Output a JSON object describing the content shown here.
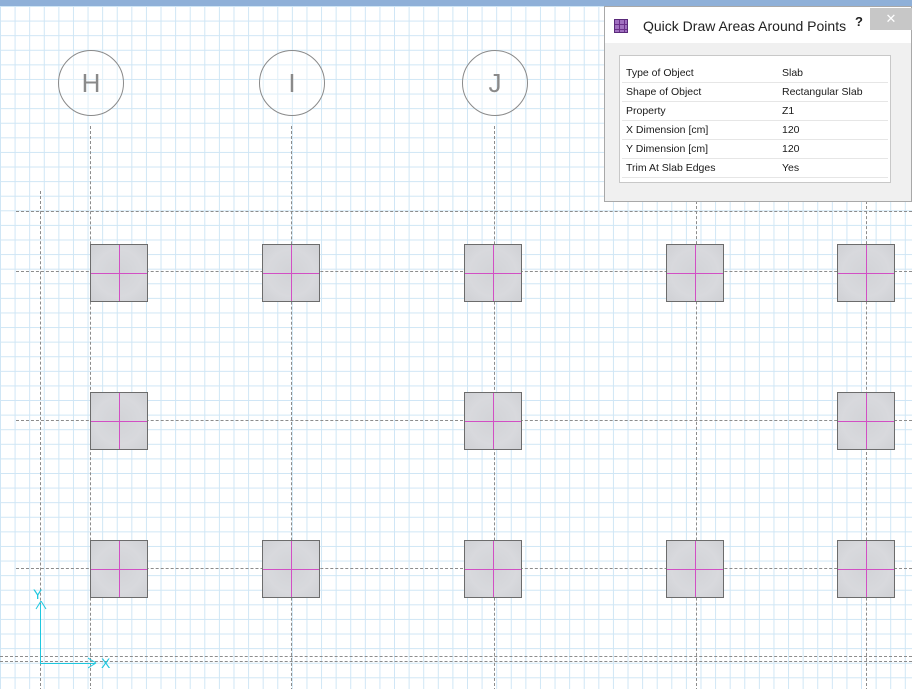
{
  "grid_bubbles": [
    "H",
    "I",
    "J"
  ],
  "axes": {
    "x_label": "X",
    "y_label": "Y"
  },
  "dialog": {
    "title": "Quick Draw Areas Around Points",
    "help_label": "?",
    "close_label": "✕",
    "properties": [
      {
        "name": "Type of Object",
        "value": "Slab"
      },
      {
        "name": "Shape of Object",
        "value": "Rectangular Slab"
      },
      {
        "name": "Property",
        "value": "Z1"
      },
      {
        "name": "X Dimension  [cm]",
        "value": "120"
      },
      {
        "name": "Y Dimension  [cm]",
        "value": "120"
      },
      {
        "name": "Trim At Slab Edges",
        "value": "Yes"
      }
    ]
  },
  "colors": {
    "grid": "#cfe6f5",
    "slab_fill": "#d5d6da",
    "slab_center_mark": "#d24fc4",
    "axis": "#1ec7df",
    "dialog_bg": "#f0f0f0"
  }
}
